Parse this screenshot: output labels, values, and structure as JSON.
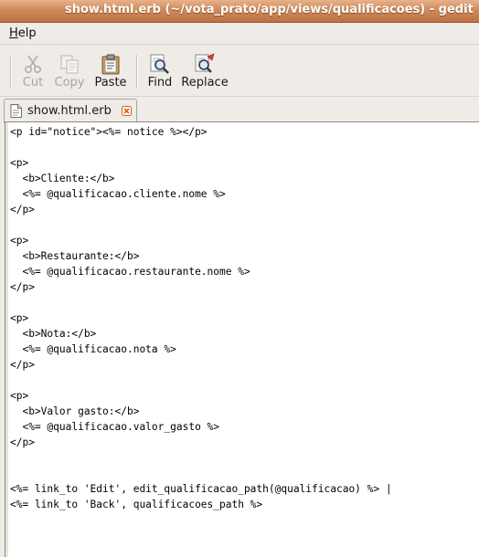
{
  "window": {
    "title": "show.html.erb (~/vota_prato/app/views/qualificacoes) - gedit"
  },
  "menubar": {
    "items": [
      {
        "label": "Help",
        "mnemonic": "H",
        "rest": "elp"
      }
    ]
  },
  "toolbar": {
    "cut_label": "Cut",
    "copy_label": "Copy",
    "paste_label": "Paste",
    "find_label": "Find",
    "replace_label": "Replace"
  },
  "tabs": [
    {
      "label": "show.html.erb",
      "icon": "document-icon",
      "close_icon": "close-icon"
    }
  ],
  "editor": {
    "lines": [
      "<p id=\"notice\"><%= notice %></p>",
      "",
      "<p>",
      "  <b>Cliente:</b>",
      "  <%= @qualificacao.cliente.nome %>",
      "</p>",
      "",
      "<p>",
      "  <b>Restaurante:</b>",
      "  <%= @qualificacao.restaurante.nome %>",
      "</p>",
      "",
      "<p>",
      "  <b>Nota:</b>",
      "  <%= @qualificacao.nota %>",
      "</p>",
      "",
      "<p>",
      "  <b>Valor gasto:</b>",
      "  <%= @qualificacao.valor_gasto %>",
      "</p>",
      "",
      "",
      "<%= link_to 'Edit', edit_qualificacao_path(@qualificacao) %> |",
      "<%= link_to 'Back', qualificacoes_path %>"
    ]
  },
  "colors": {
    "titlebar_accent": "#d08a5a",
    "window_bg": "#efebe7",
    "editor_bg": "#ffffff",
    "close_icon": "#e05a1e"
  }
}
